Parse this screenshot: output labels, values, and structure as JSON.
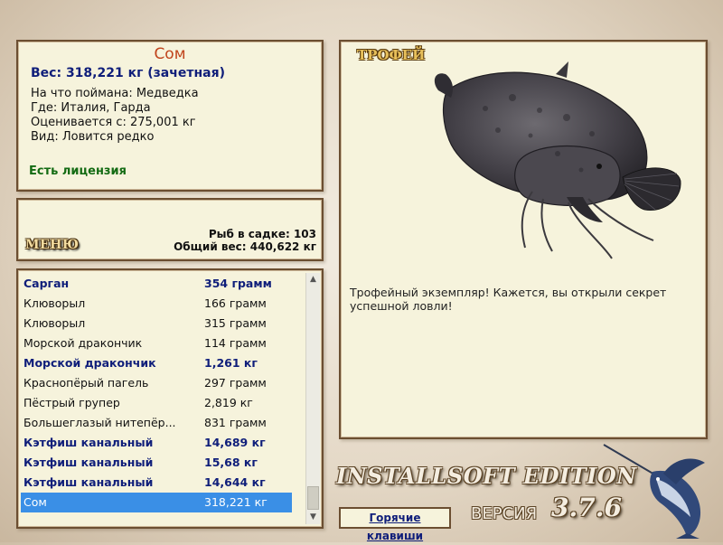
{
  "fish_info": {
    "name": "Сом",
    "weight_line": "Вес: 318,221 кг (зачетная)",
    "bait_line": "На что поймана: Медведка",
    "location_line": "Где: Италия, Гарда",
    "valued_line": "Оценивается с: 275,001 кг",
    "species_line": "Вид: Ловится редко",
    "license": "Есть лицензия"
  },
  "menu": {
    "label": "МЕНЮ",
    "fish_count": "Рыб в садке: 103",
    "total_weight": "Общий вес: 440,622 кг"
  },
  "catch_list": [
    {
      "name": "Сарган",
      "weight": "354 грамм",
      "bold": true
    },
    {
      "name": "Клюворыл",
      "weight": "166 грамм",
      "bold": false
    },
    {
      "name": "Клюворыл",
      "weight": "315 грамм",
      "bold": false
    },
    {
      "name": "Морской дракончик",
      "weight": "114 грамм",
      "bold": false
    },
    {
      "name": "Морской дракончик",
      "weight": "1,261 кг",
      "bold": true
    },
    {
      "name": "Краснопёрый пагель",
      "weight": "297 грамм",
      "bold": false
    },
    {
      "name": "Пёстрый групер",
      "weight": "2,819 кг",
      "bold": false
    },
    {
      "name": "Большеглазый нитепёр...",
      "weight": "831 грамм",
      "bold": false
    },
    {
      "name": "Кэтфиш канальный",
      "weight": "14,689 кг",
      "bold": true
    },
    {
      "name": "Кэтфиш канальный",
      "weight": "15,68 кг",
      "bold": true
    },
    {
      "name": "Кэтфиш канальный",
      "weight": "14,644 кг",
      "bold": true
    },
    {
      "name": "Сом",
      "weight": "318,221 кг",
      "bold": false,
      "selected": true
    }
  ],
  "trophy": {
    "title": "ТРОФЕЙ",
    "description": "Трофейный экземпляр! Кажется, вы открыли секрет успешной ловли!"
  },
  "branding": {
    "edition": "INSTALLSOFT EDITION",
    "version_label": "ВЕРСИЯ",
    "version_number": "3.7.6"
  },
  "hotkeys_label": "Горячие клавиши",
  "icons": {
    "scroll_up": "▲",
    "scroll_down": "▼"
  },
  "colors": {
    "accent_name": "#c0441c",
    "bold_blue": "#0f1e7a",
    "license_green": "#136b13",
    "selection": "#3a8fe6",
    "panel_bg": "#f6f3dc",
    "panel_border": "#6b4e31"
  }
}
